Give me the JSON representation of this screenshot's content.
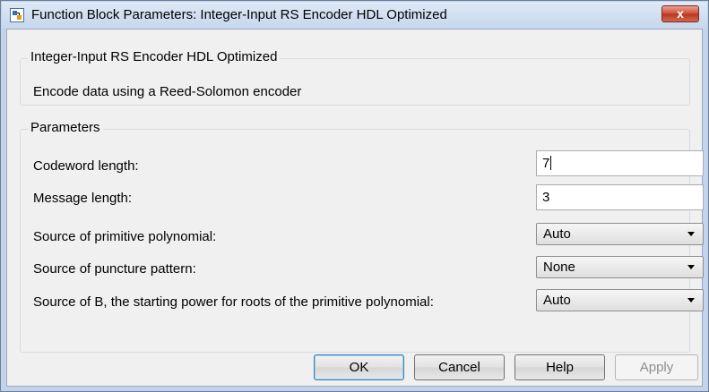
{
  "window": {
    "title": "Function Block Parameters: Integer-Input RS Encoder HDL Optimized",
    "close_label": "x",
    "icon": "simulink-block-icon"
  },
  "block": {
    "name": "Integer-Input RS Encoder HDL Optimized",
    "description": "Encode data using a Reed-Solomon encoder"
  },
  "parameters": {
    "heading": "Parameters",
    "codeword_length": {
      "label": "Codeword length:",
      "value": "7"
    },
    "message_length": {
      "label": "Message length:",
      "value": "3"
    },
    "primitive_polynomial_source": {
      "label": "Source of primitive polynomial:",
      "value": "Auto"
    },
    "puncture_pattern_source": {
      "label": "Source of puncture pattern:",
      "value": "None"
    },
    "b_source": {
      "label": "Source of B, the starting power for roots of the primitive polynomial:",
      "value": "Auto"
    }
  },
  "buttons": {
    "ok": "OK",
    "cancel": "Cancel",
    "help": "Help",
    "apply": "Apply"
  }
}
